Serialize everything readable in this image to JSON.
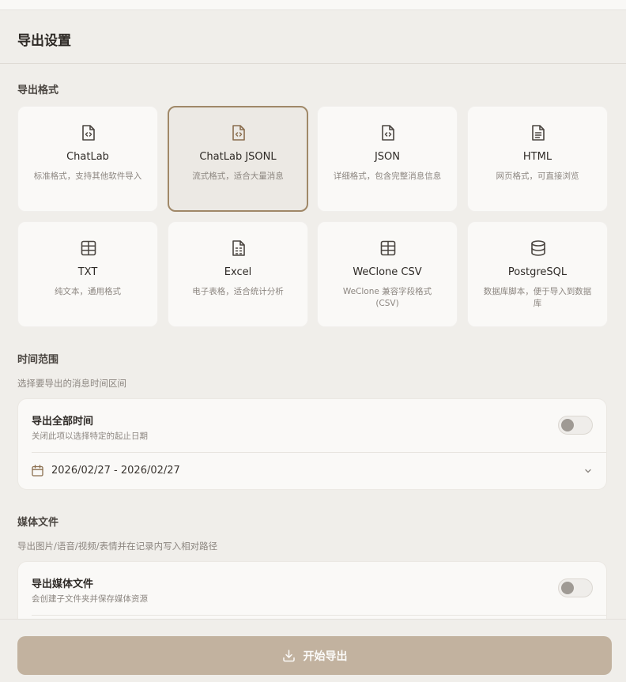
{
  "header": {
    "title": "导出设置"
  },
  "format_section": {
    "title": "导出格式",
    "cards": [
      {
        "name": "ChatLab",
        "desc": "标准格式，支持其他软件导入",
        "icon": "file-code-icon",
        "selected": false
      },
      {
        "name": "ChatLab JSONL",
        "desc": "流式格式，适合大量消息",
        "icon": "file-code-icon",
        "selected": true
      },
      {
        "name": "JSON",
        "desc": "详细格式，包含完整消息信息",
        "icon": "file-code-icon",
        "selected": false
      },
      {
        "name": "HTML",
        "desc": "网页格式，可直接浏览",
        "icon": "file-text-icon",
        "selected": false
      },
      {
        "name": "TXT",
        "desc": "纯文本，通用格式",
        "icon": "table-icon",
        "selected": false
      },
      {
        "name": "Excel",
        "desc": "电子表格，适合统计分析",
        "icon": "file-spreadsheet-icon",
        "selected": false
      },
      {
        "name": "WeClone CSV",
        "desc": "WeClone 兼容字段格式 (CSV)",
        "icon": "table-icon",
        "selected": false
      },
      {
        "name": "PostgreSQL",
        "desc": "数据库脚本，便于导入到数据库",
        "icon": "database-icon",
        "selected": false
      }
    ]
  },
  "time_section": {
    "title": "时间范围",
    "desc": "选择要导出的消息时间区间",
    "toggle_title": "导出全部时间",
    "toggle_sub": "关闭此项以选择特定的起止日期",
    "toggle_on": false,
    "date_range": "2026/02/27 - 2026/02/27"
  },
  "media_section": {
    "title": "媒体文件",
    "desc": "导出图片/语音/视频/表情并在记录内写入相对路径",
    "toggle_title": "导出媒体文件",
    "toggle_sub": "会创建子文件夹并保存媒体资源",
    "toggle_on": false
  },
  "footer": {
    "export_label": "开始导出"
  },
  "colors": {
    "accent": "#a08868",
    "button": "#c2b29f",
    "background": "#f0eeea"
  }
}
